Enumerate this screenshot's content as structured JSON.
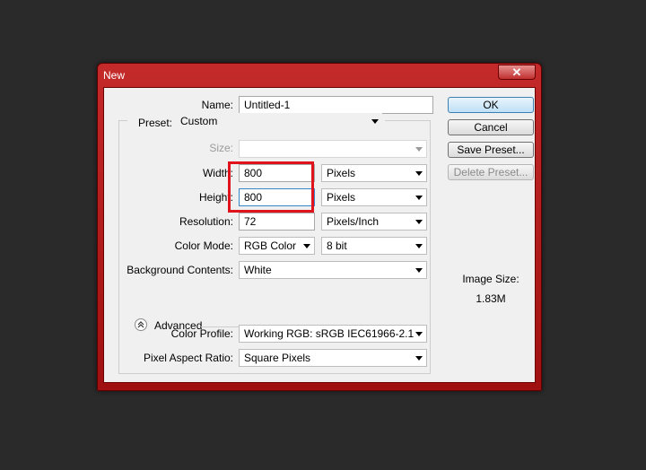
{
  "window": {
    "title": "New",
    "close_glyph": "✕"
  },
  "form": {
    "name_label": "Name:",
    "name_value": "Untitled-1",
    "preset_label": "Preset:",
    "preset_value": "Custom",
    "size_label": "Size:",
    "size_value": "",
    "width_label": "Width:",
    "width_value": "800",
    "width_unit": "Pixels",
    "height_label": "Height:",
    "height_value": "800",
    "height_unit": "Pixels",
    "resolution_label": "Resolution:",
    "resolution_value": "72",
    "resolution_unit": "Pixels/Inch",
    "color_mode_label": "Color Mode:",
    "color_mode_value": "RGB Color",
    "bit_depth_value": "8 bit",
    "background_label": "Background Contents:",
    "background_value": "White",
    "advanced_label": "Advanced",
    "color_profile_label": "Color Profile:",
    "color_profile_value": "Working RGB:  sRGB IEC61966-2.1",
    "pixel_aspect_label": "Pixel Aspect Ratio:",
    "pixel_aspect_value": "Square Pixels"
  },
  "buttons": {
    "ok": "OK",
    "cancel": "Cancel",
    "save_preset": "Save Preset...",
    "delete_preset": "Delete Preset..."
  },
  "info": {
    "image_size_label": "Image Size:",
    "image_size_value": "1.83M"
  },
  "colors": {
    "titlebar": "#b01818",
    "highlight": "#e0121c",
    "dialog_bg": "#f0f0f0"
  }
}
